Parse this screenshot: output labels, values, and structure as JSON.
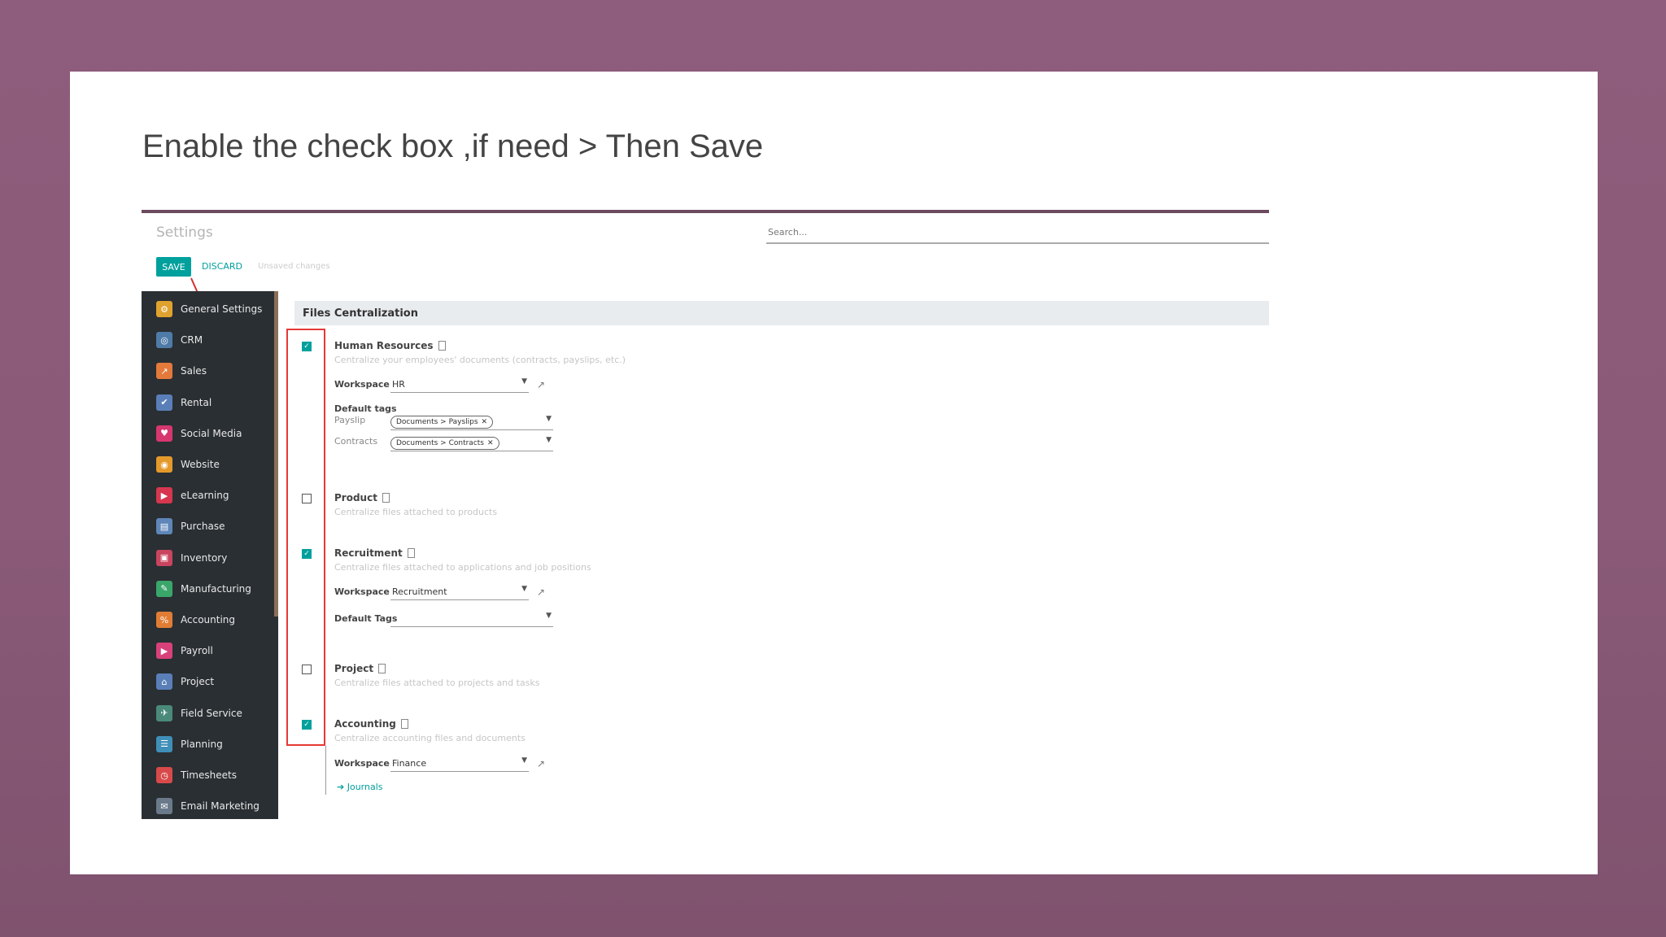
{
  "caption": "Enable the check box ,if need > Then Save",
  "app": {
    "title": "Settings",
    "search_placeholder": "Search...",
    "save_label": "SAVE",
    "discard_label": "DISCARD",
    "unsaved_label": "Unsaved changes"
  },
  "sidebar": {
    "items": [
      {
        "label": "General Settings",
        "color": "#e0a22e",
        "icon": "gear-icon",
        "glyph": "⚙"
      },
      {
        "label": "CRM",
        "color": "#4f7ba8",
        "icon": "crm-icon",
        "glyph": "◎"
      },
      {
        "label": "Sales",
        "color": "#e37a3c",
        "icon": "sales-icon",
        "glyph": "↗"
      },
      {
        "label": "Rental",
        "color": "#5a7fb8",
        "icon": "rental-icon",
        "glyph": "✔"
      },
      {
        "label": "Social Media",
        "color": "#d6376f",
        "icon": "social-media-icon",
        "glyph": "♥"
      },
      {
        "label": "Website",
        "color": "#e49a2b",
        "icon": "website-icon",
        "glyph": "◉"
      },
      {
        "label": "eLearning",
        "color": "#d6374f",
        "icon": "elearning-icon",
        "glyph": "▶"
      },
      {
        "label": "Purchase",
        "color": "#5e86b8",
        "icon": "purchase-icon",
        "glyph": "▤"
      },
      {
        "label": "Inventory",
        "color": "#c9445f",
        "icon": "inventory-icon",
        "glyph": "▣"
      },
      {
        "label": "Manufacturing",
        "color": "#3aa66a",
        "icon": "manufacturing-icon",
        "glyph": "✎"
      },
      {
        "label": "Accounting",
        "color": "#e07d34",
        "icon": "accounting-icon",
        "glyph": "%"
      },
      {
        "label": "Payroll",
        "color": "#d8417a",
        "icon": "payroll-icon",
        "glyph": "▶"
      },
      {
        "label": "Project",
        "color": "#5a7fb8",
        "icon": "project-icon",
        "glyph": "⌂"
      },
      {
        "label": "Field Service",
        "color": "#4b8a7a",
        "icon": "field-service-icon",
        "glyph": "✈"
      },
      {
        "label": "Planning",
        "color": "#3f8fb8",
        "icon": "planning-icon",
        "glyph": "☰"
      },
      {
        "label": "Timesheets",
        "color": "#d84a4a",
        "icon": "timesheets-icon",
        "glyph": "◷"
      },
      {
        "label": "Email Marketing",
        "color": "#6a7a8a",
        "icon": "email-marketing-icon",
        "glyph": "✉"
      }
    ]
  },
  "section": {
    "title": "Files Centralization",
    "hr": {
      "title": "Human Resources",
      "desc": "Centralize your employees' documents (contracts, payslips, etc.)",
      "checked": true,
      "workspace_label": "Workspace",
      "workspace_value": "HR",
      "default_tags_label": "Default tags",
      "payslip_label": "Payslip",
      "payslip_tag": "Documents > Payslips",
      "contracts_label": "Contracts",
      "contracts_tag": "Documents > Contracts"
    },
    "product": {
      "title": "Product",
      "desc": "Centralize files attached to products",
      "checked": false
    },
    "recruitment": {
      "title": "Recruitment",
      "desc": "Centralize files attached to applications and job positions",
      "checked": true,
      "workspace_label": "Workspace",
      "workspace_value": "Recruitment",
      "default_tags_label": "Default Tags"
    },
    "project": {
      "title": "Project",
      "desc": "Centralize files attached to projects and tasks",
      "checked": false
    },
    "accounting": {
      "title": "Accounting",
      "desc": "Centralize accounting files and documents",
      "checked": true,
      "workspace_label": "Workspace",
      "workspace_value": "Finance",
      "journals_label": "Journals"
    }
  }
}
